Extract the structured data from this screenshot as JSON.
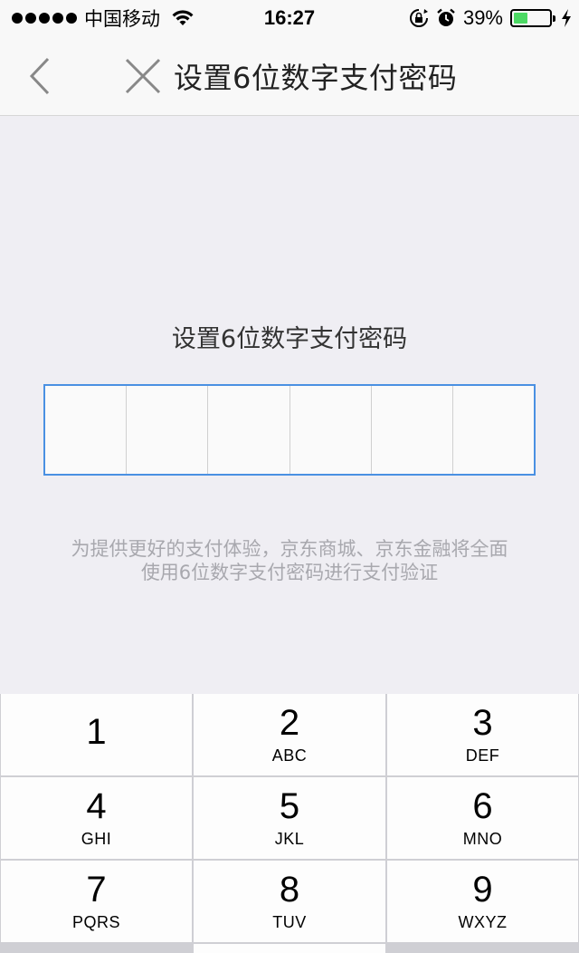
{
  "status_bar": {
    "carrier": "中国移动",
    "time": "16:27",
    "battery_percent": "39%",
    "battery_level": 0.39,
    "battery_color": "#4cd964"
  },
  "nav": {
    "title": "设置6位数字支付密码",
    "back_icon": "chevron-left-icon",
    "close_icon": "close-icon"
  },
  "main": {
    "prompt": "设置6位数字支付密码",
    "pin_length": 6,
    "accent_color": "#4a90e2",
    "notice_line1": "为提供更好的支付体验，京东商城、京东金融将全面",
    "notice_line2": "使用6位数字支付密码进行支付验证"
  },
  "keypad": {
    "keys": [
      {
        "digit": "1",
        "letters": ""
      },
      {
        "digit": "2",
        "letters": "ABC"
      },
      {
        "digit": "3",
        "letters": "DEF"
      },
      {
        "digit": "4",
        "letters": "GHI"
      },
      {
        "digit": "5",
        "letters": "JKL"
      },
      {
        "digit": "6",
        "letters": "MNO"
      },
      {
        "digit": "7",
        "letters": "PQRS"
      },
      {
        "digit": "8",
        "letters": "TUV"
      },
      {
        "digit": "9",
        "letters": "WXYZ"
      }
    ]
  }
}
